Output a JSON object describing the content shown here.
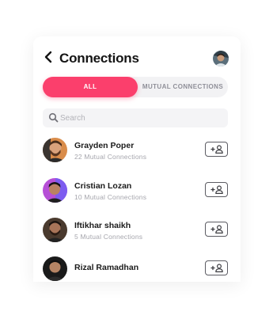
{
  "header": {
    "title": "Connections"
  },
  "tabs": [
    {
      "label": "ALL",
      "active": true
    },
    {
      "label": "MUTUAL CONNECTIONS",
      "active": false
    }
  ],
  "search": {
    "placeholder": "Search"
  },
  "contacts": [
    {
      "name": "Grayden Poper",
      "mutual": "22 Mutual Connections"
    },
    {
      "name": "Cristian Lozan",
      "mutual": "10 Mutual Connections"
    },
    {
      "name": "Iftikhar shaikh",
      "mutual": "5 Mutual Connections"
    },
    {
      "name": "Rizal Ramadhan",
      "mutual": ""
    }
  ],
  "icons": {
    "back": "chevron-left-icon",
    "search": "search-icon",
    "add": "add-user-icon"
  },
  "colors": {
    "accent": "#fb3f6c",
    "title": "#141414",
    "muted": "#a6a6ad"
  }
}
